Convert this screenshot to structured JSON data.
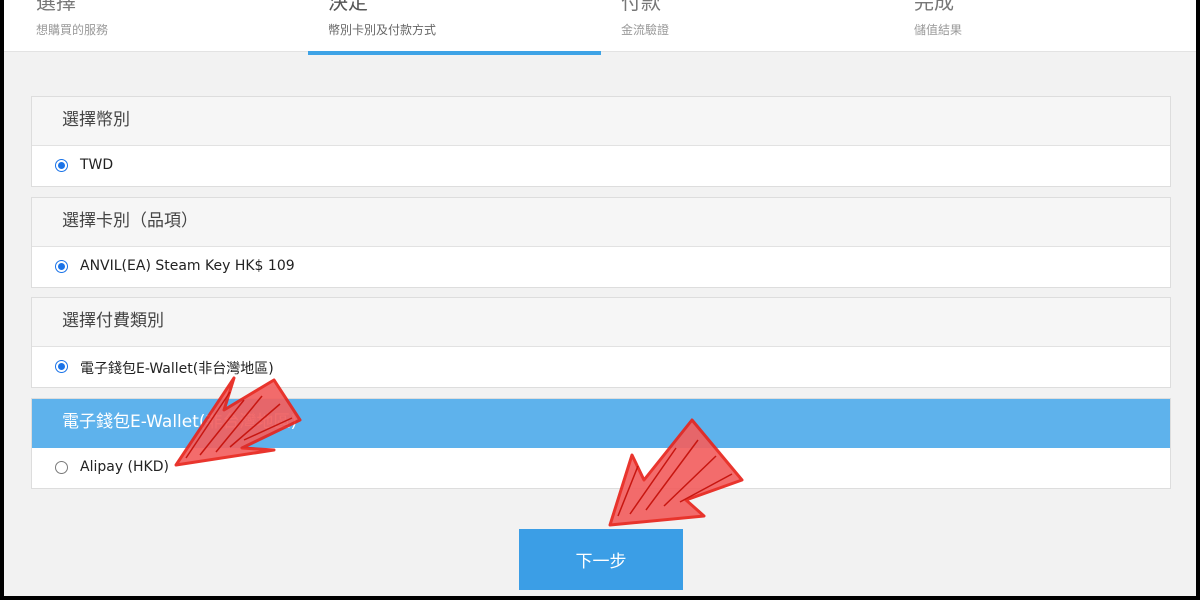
{
  "steps": [
    {
      "title": "選擇",
      "subtitle": "想購買的服務"
    },
    {
      "title": "決定",
      "subtitle": "幣別卡別及付款方式"
    },
    {
      "title": "付款",
      "subtitle": "金流驗證"
    },
    {
      "title": "完成",
      "subtitle": "儲值結果"
    }
  ],
  "active_step": 1,
  "sections": {
    "currency": {
      "heading": "選擇幣別",
      "option": "TWD",
      "selected": true
    },
    "card": {
      "heading": "選擇卡別（品項）",
      "option": "ANVIL(EA) Steam Key HK$ 109",
      "selected": true
    },
    "payment_type": {
      "heading": "選擇付費類別",
      "option": "電子錢包E-Wallet(非台灣地區)",
      "selected": true
    },
    "ewallet": {
      "heading": "電子錢包E-Wallet(非台灣地區)",
      "option": "Alipay (HKD)",
      "selected": false
    }
  },
  "next_button": "下一步",
  "colors": {
    "accent": "#3b9ee6",
    "highlight_header": "#5eb2ec",
    "annotation": "#e8241c"
  },
  "annotations": [
    "red-arrow-to-alipay",
    "red-arrow-to-next-button"
  ]
}
